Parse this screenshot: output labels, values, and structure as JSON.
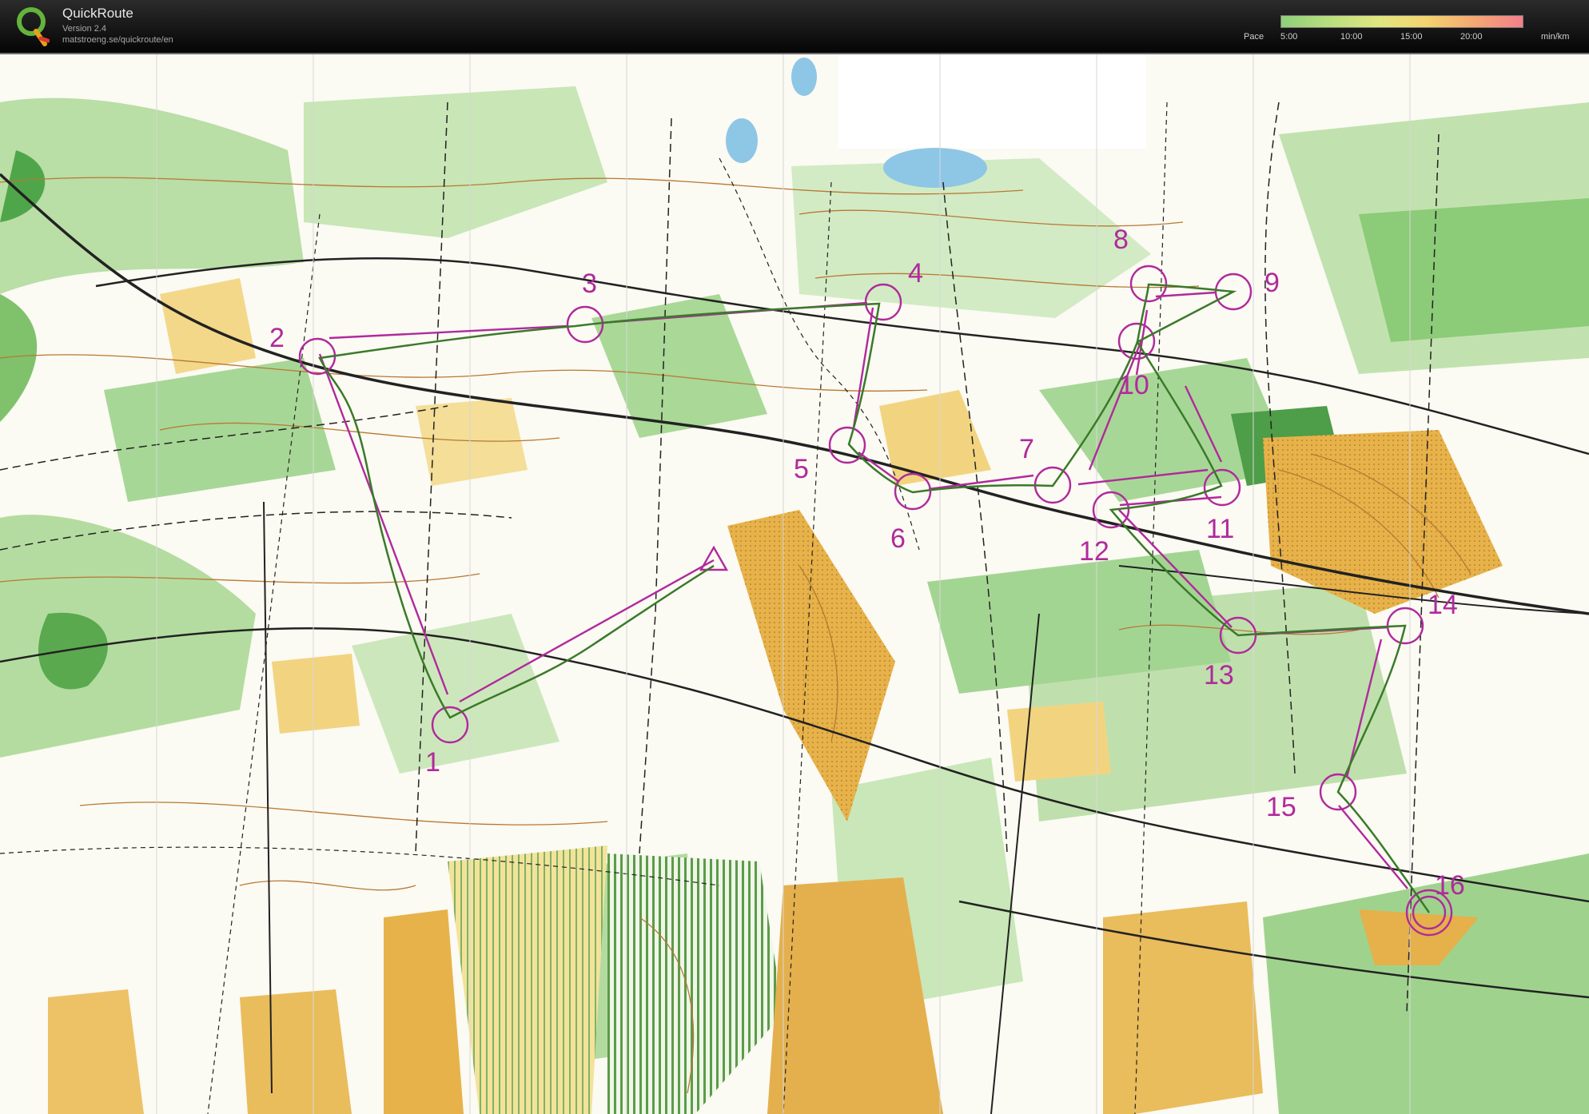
{
  "app": {
    "name": "QuickRoute",
    "version": "Version 2.4",
    "url": "matstroeng.se/quickroute/en"
  },
  "pace_legend": {
    "label": "Pace",
    "ticks": [
      "5:00",
      "10:00",
      "15:00",
      "20:00"
    ],
    "unit": "min/km"
  },
  "map": {
    "course_color": "#b02a9c",
    "controls": [
      "1",
      "2",
      "3",
      "4",
      "5",
      "6",
      "7",
      "8",
      "9",
      "10",
      "11",
      "12",
      "13",
      "14",
      "15",
      "16"
    ]
  }
}
